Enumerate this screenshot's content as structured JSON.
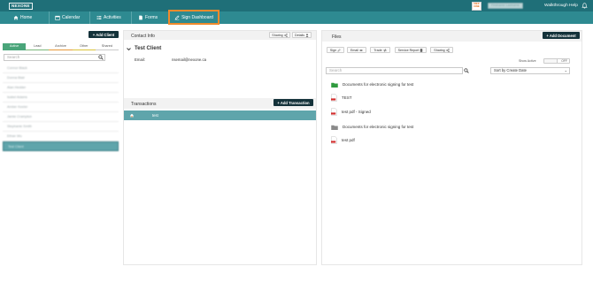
{
  "header": {
    "logo": "NEXONE",
    "nex_logo": [
      "NEX",
      "ONE"
    ],
    "user": "Firstname Lastname",
    "links": [
      "Walkthrough",
      "Help"
    ]
  },
  "nav": {
    "items": [
      "Home",
      "Calendar",
      "Activities",
      "Forms"
    ],
    "active": "Sign Dashboard"
  },
  "clients": {
    "add_button": "+ Add Client",
    "tabs": [
      "Active",
      "Lead",
      "Archive",
      "Other",
      "Shared"
    ],
    "active_tab": "Active",
    "search_placeholder": "Search",
    "rows": [
      "Connor Black",
      "Donna Blair",
      "Alan Hedder",
      "Isabel Adams",
      "Amber Keeler",
      "Jamie Crampton",
      "Stephanie Smith",
      "Ethan Wu",
      "Test Client"
    ],
    "selected": "Test Client"
  },
  "contact": {
    "title": "Contact Info",
    "sharing": "Sharing",
    "details": "Details",
    "name": "Test Client",
    "email_label": "Email:",
    "email": "nsemail@nexone.ca"
  },
  "transactions": {
    "title": "Transactions",
    "add_button": "+ Add Transaction",
    "rows": [
      {
        "name": "test"
      }
    ]
  },
  "files": {
    "title": "Files",
    "add_button": "+ Add Document",
    "toolbar": [
      "Sign",
      "Email",
      "Trade",
      "Service Report",
      "Sharing"
    ],
    "show_active_label": "Show Active",
    "toggle_label": "OFF",
    "search_placeholder": "Search",
    "sort": "Sort by Create Date",
    "items": [
      {
        "name": "Documents for electronic signing for test",
        "type": "folder",
        "color": "#2e9a3e"
      },
      {
        "name": "TEST",
        "type": "pdf"
      },
      {
        "name": "test pdf - Signed",
        "type": "pdf"
      },
      {
        "name": "Documents for electronic signing for test",
        "type": "folder",
        "color": "#8a8a8a"
      },
      {
        "name": "test pdf",
        "type": "pdf"
      }
    ]
  },
  "colors": {
    "topbar": "#1f6f78",
    "navbar": "#2e8a91",
    "active_outline": "#f08a2c",
    "selected_row": "#5fa5ab",
    "dark_button": "#14323a"
  }
}
